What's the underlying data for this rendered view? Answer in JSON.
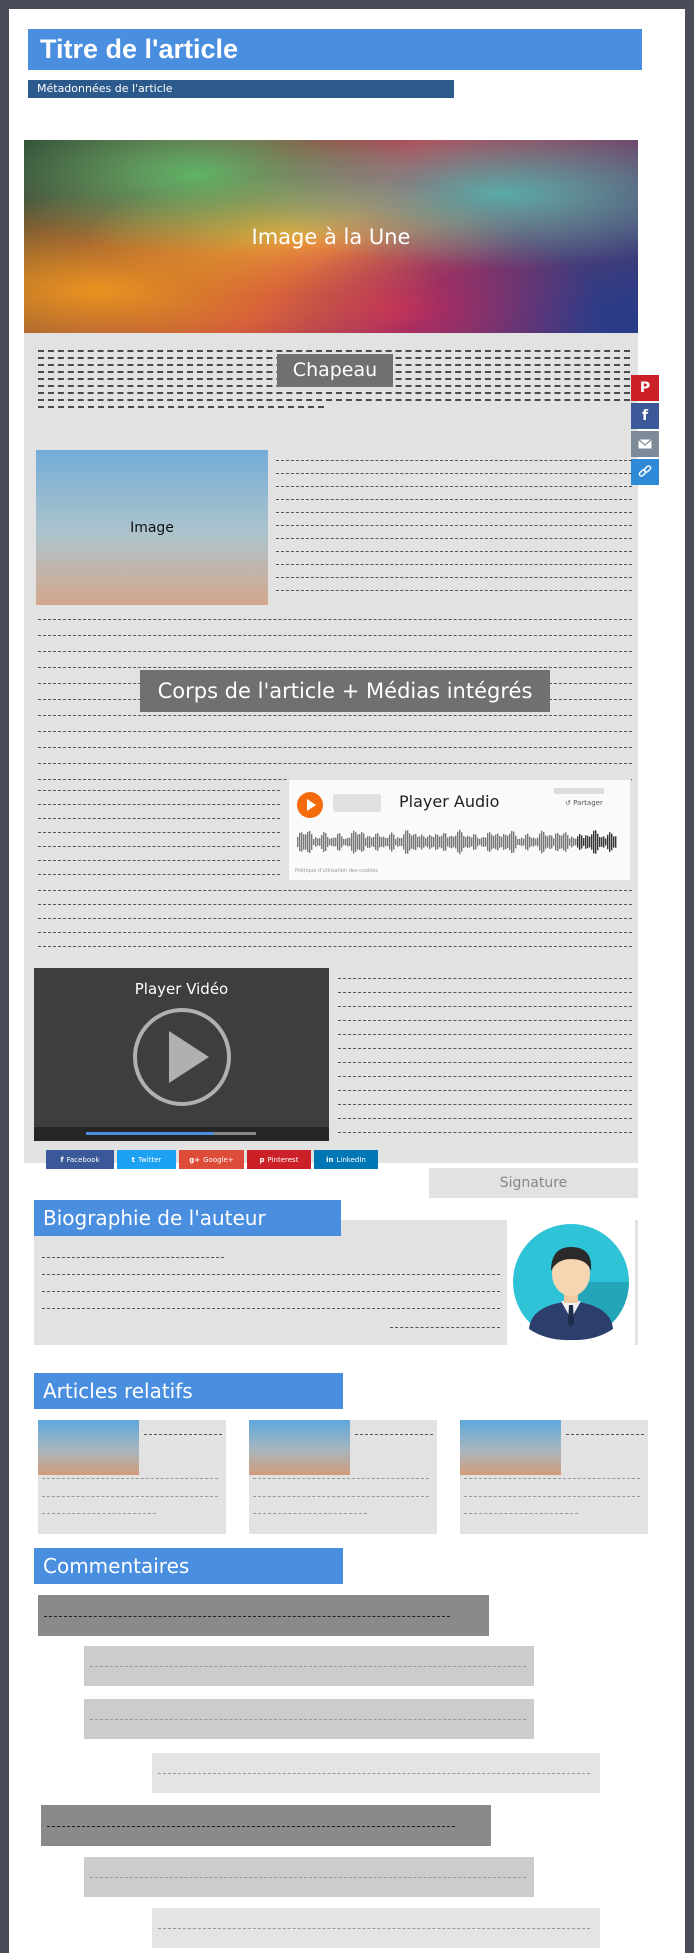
{
  "article": {
    "title": "Titre de l'article",
    "metadata": "Métadonnées de l'article",
    "featured_image": "Image à la Une",
    "lead": "Chapeau",
    "inline_image": "Image",
    "body": "Corps de l'article + Médias intégrés",
    "signature": "Signature"
  },
  "share_sidebar": {
    "icons": [
      "pinterest-icon",
      "facebook-icon",
      "email-icon",
      "link-icon"
    ],
    "colors": [
      "#cb2027",
      "#3b5998",
      "#7d8b99",
      "#2f8ad8"
    ]
  },
  "audio_player": {
    "label": "Player Audio",
    "share_label": "Partager",
    "footer": "Politique d'utilisation des cookies"
  },
  "video_player": {
    "label": "Player Vidéo"
  },
  "share_buttons": [
    {
      "label": "Facebook",
      "color": "#3b5998",
      "icon": "f"
    },
    {
      "label": "Twitter",
      "color": "#1da1f2",
      "icon": "t"
    },
    {
      "label": "Google+",
      "color": "#dd4b39",
      "icon": "g+"
    },
    {
      "label": "Pinterest",
      "color": "#cb2027",
      "icon": "p"
    },
    {
      "label": "LinkedIn",
      "color": "#0077b5",
      "icon": "in"
    }
  ],
  "author_bio": {
    "heading": "Biographie de l'auteur"
  },
  "related": {
    "heading": "Articles relatifs"
  },
  "comments": {
    "heading": "Commentaires"
  },
  "colors": {
    "accent": "#4a8ee0",
    "meta": "#2d5a8c",
    "placeholder_gray": "#e2e2e2"
  }
}
